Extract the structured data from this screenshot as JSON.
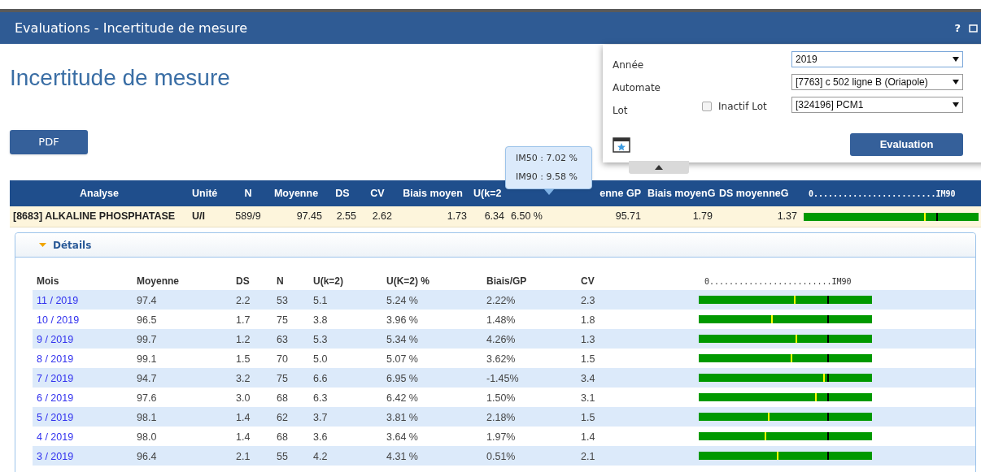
{
  "window": {
    "title": "Evaluations - Incertitude de mesure",
    "help": "?"
  },
  "page_title": "Incertitude de mesure",
  "pdf_button": "PDF",
  "filter_panel": {
    "fields": [
      {
        "label": "Année",
        "value": "2019",
        "focused": true
      },
      {
        "label": "Automate",
        "value": "[7763] c 502 ligne B (Oriapole)",
        "focused": false
      },
      {
        "label": "Lot",
        "value": "[324196] PCM1",
        "focused": false
      }
    ],
    "inactive_lot": {
      "label": "Inactif Lot",
      "checked": false
    },
    "evaluation_button": "Evaluation"
  },
  "summary_table": {
    "columns": [
      "Analyse",
      "Unité",
      "N",
      "Moyenne",
      "DS",
      "CV",
      "Biais moyen",
      "U(k=2",
      "",
      "enne GP",
      "Biais moyenG",
      "DS moyenneG",
      "0.........................IM90"
    ],
    "rows": [
      {
        "cells": [
          "[8683] ALKALINE PHOSPHATASE",
          "U/I",
          "589/9",
          "97.45",
          "2.55",
          "2.62",
          "1.73",
          "6.34",
          "6.50 %",
          "95.71",
          "1.79",
          "1.37"
        ],
        "markers": [
          {
            "kind": "value",
            "level": 0.69
          },
          {
            "kind": "limit",
            "level": 0.76
          }
        ]
      }
    ]
  },
  "tooltip": {
    "lines": [
      "IM50 : 7.02 %",
      "IM90 : 9.58 %"
    ]
  },
  "details": {
    "title": "Détails",
    "expanded": true,
    "columns": [
      "Mois",
      "Moyenne",
      "DS",
      "N",
      "U(k=2)",
      "U(K=2) %",
      "Biais/GP",
      "CV",
      "0.........................IM90"
    ],
    "rows": [
      {
        "cells": [
          "11 / 2019",
          "97.4",
          "2.2",
          "53",
          "5.1",
          "5.24 %",
          "2.22%",
          "2.3"
        ],
        "markers": [
          {
            "kind": "value",
            "level": 0.55
          },
          {
            "kind": "limit",
            "level": 0.74
          }
        ]
      },
      {
        "cells": [
          "10 / 2019",
          "96.5",
          "1.7",
          "75",
          "3.8",
          "3.96 %",
          "1.48%",
          "1.8"
        ],
        "markers": [
          {
            "kind": "value",
            "level": 0.42
          },
          {
            "kind": "limit",
            "level": 0.74
          }
        ]
      },
      {
        "cells": [
          "9 / 2019",
          "99.7",
          "1.2",
          "63",
          "5.3",
          "5.34 %",
          "4.26%",
          "1.3"
        ],
        "markers": [
          {
            "kind": "value",
            "level": 0.56
          },
          {
            "kind": "limit",
            "level": 0.74
          }
        ]
      },
      {
        "cells": [
          "8 / 2019",
          "99.1",
          "1.5",
          "70",
          "5.0",
          "5.07 %",
          "3.62%",
          "1.5"
        ],
        "markers": [
          {
            "kind": "value",
            "level": 0.53
          },
          {
            "kind": "limit",
            "level": 0.74
          }
        ]
      },
      {
        "cells": [
          "7 / 2019",
          "94.7",
          "3.2",
          "75",
          "6.6",
          "6.95 %",
          "-1.45%",
          "3.4"
        ],
        "markers": [
          {
            "kind": "value",
            "level": 0.72
          },
          {
            "kind": "limit",
            "level": 0.74
          }
        ]
      },
      {
        "cells": [
          "6 / 2019",
          "97.6",
          "3.0",
          "68",
          "6.3",
          "6.42 %",
          "1.50%",
          "3.1"
        ],
        "markers": [
          {
            "kind": "value",
            "level": 0.67
          },
          {
            "kind": "limit",
            "level": 0.74
          }
        ]
      },
      {
        "cells": [
          "5 / 2019",
          "98.1",
          "1.4",
          "62",
          "3.7",
          "3.81 %",
          "2.18%",
          "1.5"
        ],
        "markers": [
          {
            "kind": "value",
            "level": 0.4
          },
          {
            "kind": "limit",
            "level": 0.74
          }
        ]
      },
      {
        "cells": [
          "4 / 2019",
          "98.0",
          "1.4",
          "68",
          "3.6",
          "3.64 %",
          "1.97%",
          "1.4"
        ],
        "markers": [
          {
            "kind": "value",
            "level": 0.38
          },
          {
            "kind": "limit",
            "level": 0.74
          }
        ]
      },
      {
        "cells": [
          "3 / 2019",
          "96.4",
          "2.1",
          "55",
          "4.2",
          "4.31 %",
          "0.51%",
          "2.1"
        ],
        "markers": [
          {
            "kind": "value",
            "level": 0.45
          },
          {
            "kind": "limit",
            "level": 0.74
          }
        ]
      }
    ]
  }
}
